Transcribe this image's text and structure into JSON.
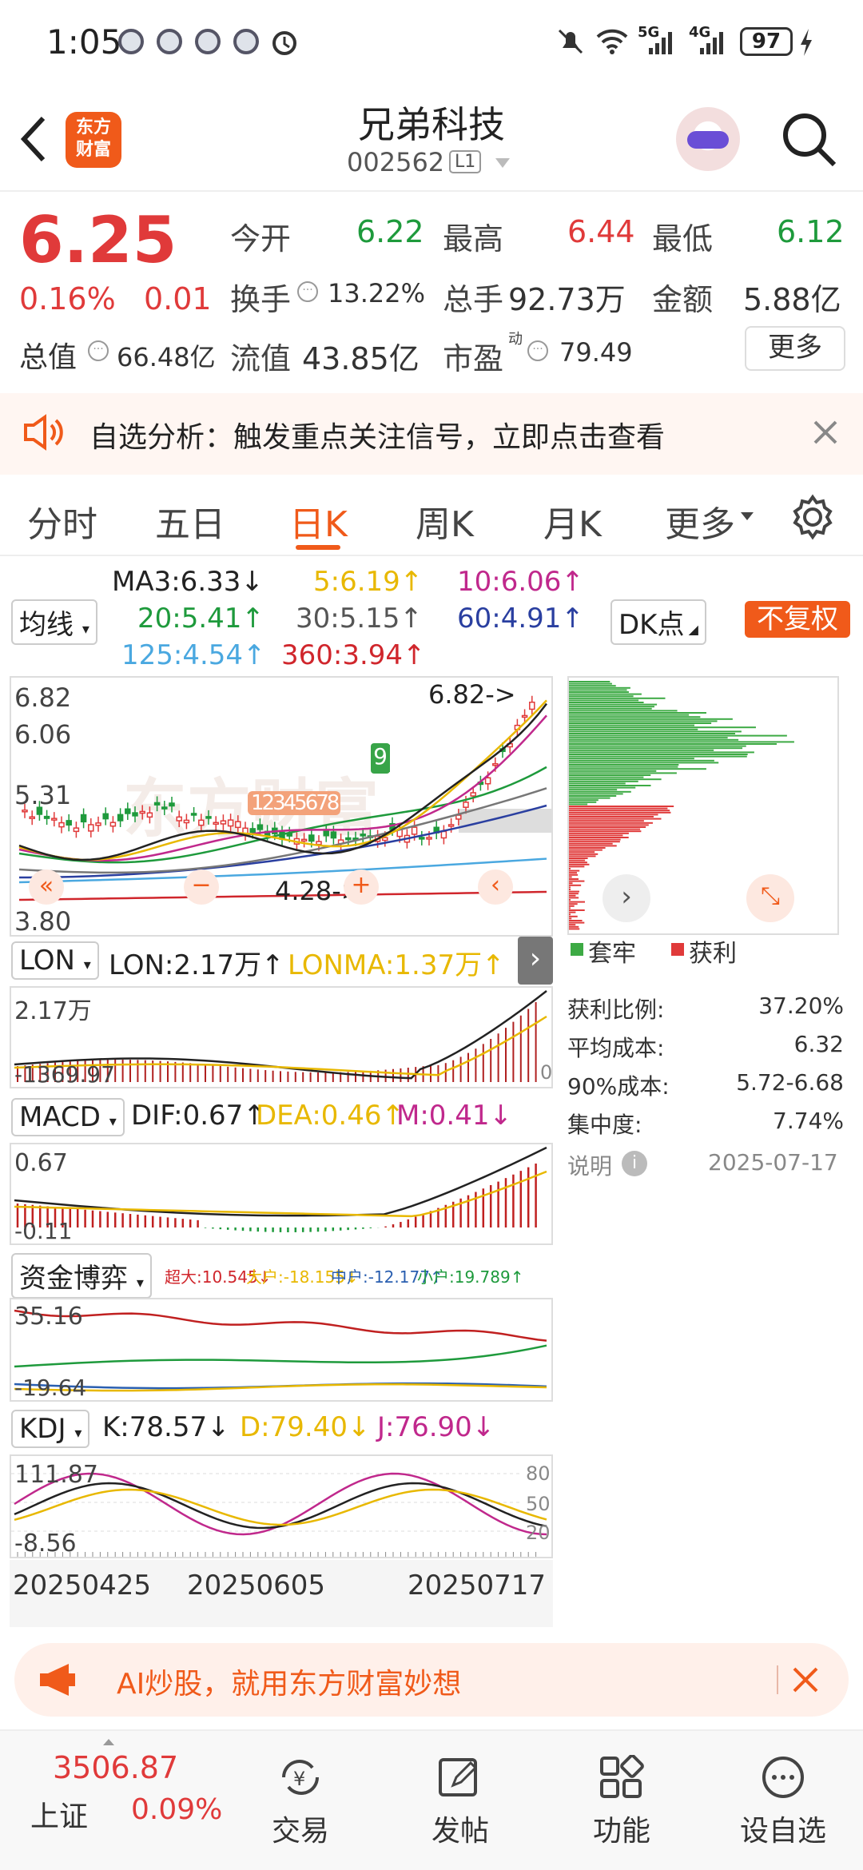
{
  "status": {
    "time": "1:05",
    "battery": "97",
    "net1": "5G",
    "net2": "4G"
  },
  "header": {
    "title": "兄弟科技",
    "code": "002562",
    "market_tag": "L1"
  },
  "quote": {
    "price": "6.25",
    "change_pct": "0.16%",
    "change": "0.01",
    "open_label": "今开",
    "open": "6.22",
    "high_label": "最高",
    "high": "6.44",
    "low_label": "最低",
    "low": "6.12",
    "turnover_label": "换手",
    "turnover": "13.22%",
    "volume_label": "总手",
    "volume": "92.73万",
    "amount_label": "金额",
    "amount": "5.88亿",
    "mcap_label": "总值",
    "mcap": "66.48亿",
    "float_label": "流值",
    "float": "43.85亿",
    "pe_label": "市盈",
    "pe_sup": "动",
    "pe": "79.49",
    "more_button": "更多"
  },
  "notice": {
    "text": "自选分析：触发重点关注信号，立即点击查看"
  },
  "tabs": [
    "分时",
    "五日",
    "日K",
    "周K",
    "月K",
    "更多"
  ],
  "active_tab": 2,
  "ma": {
    "selector": "均线",
    "ma3": "MA3:6.33↓",
    "ma5": "5:6.19↑",
    "ma10": "10:6.06↑",
    "ma20": "20:5.41↑",
    "ma30": "30:5.15↑",
    "ma60": "60:4.91↑",
    "ma125": "125:4.54↑",
    "ma360": "360:3.94↑",
    "dk_button": "DK点",
    "adjust_button": "不复权"
  },
  "kline": {
    "y_labels": [
      "6.82",
      "6.06",
      "5.31",
      "3.80"
    ],
    "high_marker": "6.82->",
    "low_marker": "4.28->",
    "seq_label": "12345678",
    "seq_9": "9",
    "watermark": "东方财富"
  },
  "lon": {
    "selector": "LON",
    "lon": "LON:2.17万↑",
    "lonma": "LONMA:1.37万↑",
    "y_top": "2.17万",
    "y_bottom": "-1369.97",
    "y_right": "0"
  },
  "macd": {
    "selector": "MACD",
    "dif": "DIF:0.67↑",
    "dea": "DEA:0.46↑",
    "m": "M:0.41↓",
    "y_top": "0.67",
    "y_bottom": "-0.11"
  },
  "fund": {
    "selector": "资金博弈",
    "super": "超大:10.545↓",
    "big": "大户:-18.155↓",
    "mid": "中户:-12.177↑",
    "small": "小户:19.789↑",
    "y_top": "35.16",
    "y_bottom": "-19.64"
  },
  "kdj": {
    "selector": "KDJ",
    "k": "K:78.57↓",
    "d": "D:79.40↓",
    "j": "J:76.90↓",
    "y_top": "111.87",
    "y_bottom": "-8.56",
    "levels": [
      "80",
      "50",
      "20"
    ]
  },
  "dates": [
    "20250425",
    "20250605",
    "20250717"
  ],
  "chips": {
    "legend_trapped": "套牢",
    "legend_profit": "获利",
    "rows": [
      {
        "label": "获利比例:",
        "value": "37.20%"
      },
      {
        "label": "平均成本:",
        "value": "6.32"
      },
      {
        "label": "90%成本:",
        "value": "5.72-6.68"
      },
      {
        "label": "集中度:",
        "value": "7.74%"
      }
    ],
    "note_label": "说明",
    "date": "2025-07-17"
  },
  "ai_banner": {
    "text": "AI炒股，就用东方财富妙想"
  },
  "bottom": {
    "index_value": "3506.87",
    "index_name": "上证",
    "index_change": "0.09%",
    "nav": [
      "交易",
      "发帖",
      "功能",
      "设自选"
    ]
  },
  "colors": {
    "up": "#e03a3a",
    "down": "#1e9a3c",
    "accent": "#f05a1a",
    "ma5": "#e8b800",
    "ma10": "#c0288c",
    "ma60": "#2a3fa0",
    "ma125": "#4aa8e0"
  }
}
